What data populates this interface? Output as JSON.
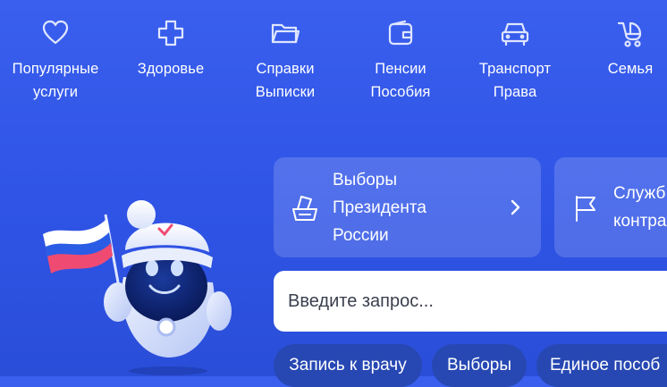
{
  "categories": [
    {
      "icon": "heart-icon",
      "lines": [
        "Популярные",
        "услуги"
      ]
    },
    {
      "icon": "plus-icon",
      "lines": [
        "Здоровье",
        ""
      ]
    },
    {
      "icon": "folder-icon",
      "lines": [
        "Справки",
        "Выписки"
      ]
    },
    {
      "icon": "wallet-icon",
      "lines": [
        "Пенсии",
        "Пособия"
      ]
    },
    {
      "icon": "car-icon",
      "lines": [
        "Транспорт",
        "Права"
      ]
    },
    {
      "icon": "stroller-icon",
      "lines": [
        "Семья",
        ""
      ]
    }
  ],
  "cards": [
    {
      "icon": "ballot-box-icon",
      "lines": [
        "Выборы",
        "Президента",
        "России"
      ]
    },
    {
      "icon": "flag-icon",
      "lines": [
        "Служб",
        "контра"
      ]
    }
  ],
  "search": {
    "placeholder": "Введите запрос..."
  },
  "chips": [
    "Запись к врачу",
    "Выборы",
    "Единое пособ"
  ],
  "colors": {
    "background": "#3a5fee",
    "card": "rgba(255,255,255,0.16)",
    "chip": "#2748b3",
    "search_bg": "#ffffff"
  }
}
